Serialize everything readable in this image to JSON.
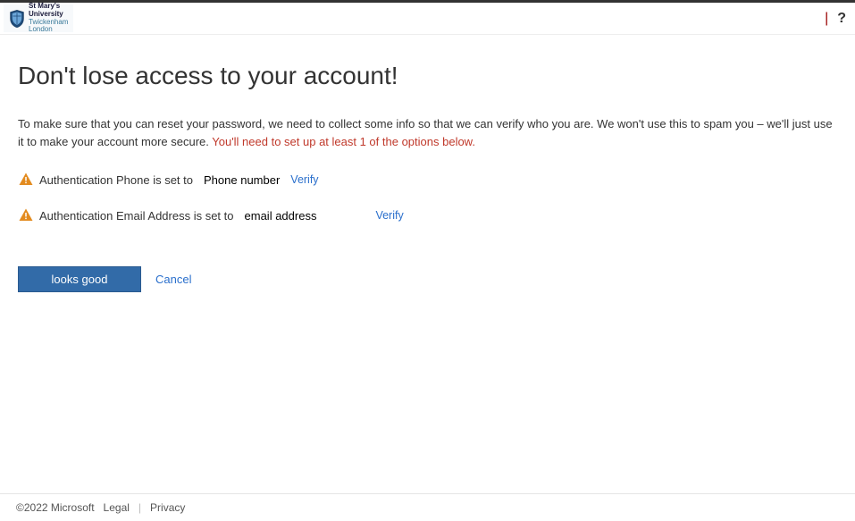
{
  "header": {
    "logo": {
      "line1": "St Mary's",
      "line2": "University",
      "line3": "Twickenham",
      "line4": "London"
    },
    "help_glyph": "?"
  },
  "page": {
    "title": "Don't lose access to your account!",
    "intro_plain": "To make sure that you can reset your password, we need to collect some info so that we can verify who you are. We won't use this to spam you – we'll just use it to make your account more secure. ",
    "intro_warning": "You'll need to set up at least 1 of the options below."
  },
  "auth": {
    "phone": {
      "label": "Authentication Phone is set to",
      "value": "Phone number",
      "verify": "Verify"
    },
    "email": {
      "label": "Authentication Email Address is set to",
      "value": "email address",
      "verify": "Verify"
    }
  },
  "buttons": {
    "primary": "looks good",
    "cancel": "Cancel"
  },
  "footer": {
    "copyright": "©2022 Microsoft",
    "legal": "Legal",
    "privacy": "Privacy"
  }
}
